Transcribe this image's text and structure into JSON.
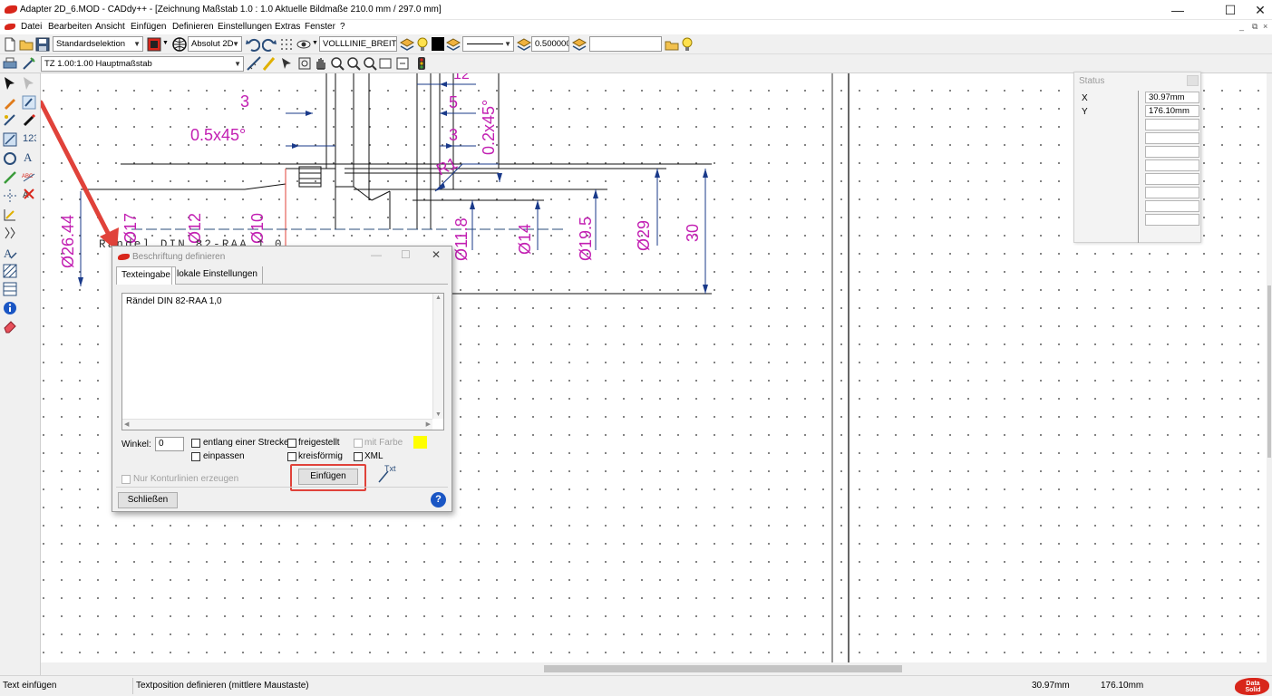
{
  "window": {
    "title": "Adapter 2D_6.MOD  -  CADdy++ - [Zeichnung   Maßstab 1.0 : 1.0   Aktuelle Bildmaße 210.0 mm / 297.0 mm]",
    "minimize_glyph": "—",
    "maximize_glyph": "☐",
    "close_glyph": "✕"
  },
  "menu": {
    "items": [
      "Datei",
      "Bearbeiten",
      "Ansicht",
      "Einfügen",
      "Definieren",
      "Einstellungen",
      "Extras",
      "Fenster",
      "?"
    ],
    "mdi_min": "_",
    "mdi_restore": "⧉",
    "mdi_close": "×"
  },
  "toolbar1": {
    "selection_mode": "Standardselektion",
    "coord_mode": "Absolut 2D",
    "layer_name": "VOLLLINIE_BREIT",
    "line_width": "0.500000",
    "search_value": ""
  },
  "toolbar2": {
    "scale_combo": "TZ 1.00:1.00 Hauptmaßstab"
  },
  "drawing": {
    "dims": [
      "3",
      "5",
      "0.5x45°",
      "3",
      "0.2x45°",
      "R1",
      "Ø26.44",
      "Ø17",
      "Ø12",
      "Ø10",
      "Ø11.8",
      "Ø14",
      "Ø19.5",
      "Ø29",
      "30",
      "12"
    ],
    "preview_text": "Rändel DIN 82-RAA 1,0"
  },
  "status_panel": {
    "title": "Status",
    "x_label": "X",
    "y_label": "Y",
    "x_value": "30.97mm",
    "y_value": "176.10mm"
  },
  "dialog": {
    "title": "Beschriftung definieren",
    "minimize_glyph": "—",
    "maximize_glyph": "☐",
    "close_glyph": "✕",
    "tabs": [
      "Texteingabe",
      "lokale Einstellungen"
    ],
    "text_content": "Rändel DIN 82-RAA 1,0",
    "angle_label": "Winkel:",
    "angle_value": "0",
    "options": {
      "along_line": "entlang einer Strecke",
      "fit": "einpassen",
      "exempt": "freigestellt",
      "circular": "kreisförmig",
      "with_color": "mit Farbe",
      "xml": "XML",
      "contour_only": "Nur Konturlinien erzeugen"
    },
    "color_swatch": "#ffff00",
    "insert_label": "Einfügen",
    "close_label": "Schließen",
    "txt_icon_label": "Txt",
    "help_glyph": "?"
  },
  "statusbar": {
    "left": "Text einfügen",
    "hint": "Textposition definieren (mittlere Maustaste)",
    "x": "30.97mm",
    "y": "176.10mm",
    "logo_text": "Data Solid"
  },
  "colors": {
    "dimension": "#c21fb2",
    "highlight": "#e0423a",
    "accent_red": "#d8261b"
  }
}
